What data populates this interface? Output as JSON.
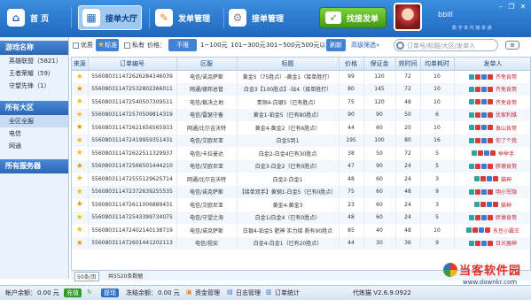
{
  "topbar": {
    "home": "首 页",
    "hall": "接单大厅",
    "send_manage": "发单管理",
    "recv_manage": "接单管理",
    "find_btn": "找接发单",
    "username": "bbill",
    "slogan": "数 字 未 代 接 单 通"
  },
  "sidebar": {
    "group1_title": "游戏名称",
    "games": [
      "英雄联盟（5821）",
      "王者荣耀（59）",
      "守望先锋（1）"
    ],
    "group2_title": "所有大区",
    "regions": [
      "全区全服",
      "电信",
      "网通"
    ],
    "group3_title": "所有服务器"
  },
  "filter": {
    "opt1": "优质",
    "opt2": "标准",
    "opt3": "私有",
    "price_label": "价格：",
    "price_all": "不限",
    "p1": "1~100元",
    "p2": "101~300元",
    "p3": "301~500元",
    "p4": "500元以上",
    "refresh": "刷新",
    "advanced": "高级筛选",
    "search_placeholder": "订单号/标题/大区/发单人"
  },
  "table": {
    "headers": [
      "来源",
      "订单编号",
      "区服",
      "标题",
      "价格",
      "保证金",
      "效时间",
      "均单耗时",
      "发单人"
    ],
    "rows": [
      {
        "order": "556080311472626284346039",
        "region": "电信/诺克萨斯",
        "title": "黄金5（75胜点）-黄金1（接单胜打）",
        "price": "99",
        "deposit": "120",
        "eff": "72",
        "avg": "10",
        "pub": "齐免肯努"
      },
      {
        "order": "556080311472532802366011",
        "region": "网通/德邦总管",
        "title": "白金3【100胜点】-钻4（接单胜打）",
        "price": "80",
        "deposit": "145",
        "eff": "72",
        "avg": "10",
        "pub": "齐免肯努"
      },
      {
        "order": "556080311472540507309511",
        "region": "电信/裁决之地",
        "title": "青铜4-白银5（已有胜点）",
        "price": "75",
        "deposit": "120",
        "eff": "48",
        "avg": "10",
        "pub": "齐免肯努"
      },
      {
        "order": "556080311472570509814319",
        "region": "电信/雷瑟守备",
        "title": "黄金1-铂金5（已有80胜点）",
        "price": "90",
        "deposit": "90",
        "eff": "50",
        "avg": "6",
        "pub": "优家利维"
      },
      {
        "order": "556080311472621656565933",
        "region": "网通/比尔吉沃特",
        "title": "黄金4-黄金2（已有6胜点）",
        "price": "44",
        "deposit": "60",
        "eff": "20",
        "avg": "10",
        "pub": "泰山肯努"
      },
      {
        "order": "556080311472419959351431",
        "region": "电信/艾欧尼亚",
        "title": "白金5到1",
        "price": "195",
        "deposit": "100",
        "eff": "80",
        "avg": "16",
        "pub": "你了个我"
      },
      {
        "order": "556080311472622511329937",
        "region": "电信/卡拉曼达",
        "title": "白金2-白金4已有30胜点",
        "price": "38",
        "deposit": "50",
        "eff": "72",
        "avg": "5",
        "pub": "举举手"
      },
      {
        "order": "556080311472566501444210",
        "region": "电信/艾欧尼亚",
        "title": "白金3-白金2（已有0胜点）",
        "price": "47",
        "deposit": "90",
        "eff": "24",
        "avg": "5",
        "pub": "胖墩肯努"
      },
      {
        "order": "556080311472555129625714",
        "region": "网通/比尔吉沃特",
        "title": "白金2-白金1",
        "price": "48",
        "deposit": "60",
        "eff": "24",
        "avg": "3",
        "pub": "猫神"
      },
      {
        "order": "556080311472372639255535",
        "region": "电信/诺克萨斯",
        "title": "【接单双手】黄钢1-白金5（已有0胜点）",
        "price": "75",
        "deposit": "60",
        "eff": "48",
        "avg": "9",
        "pub": "明小军隐"
      },
      {
        "order": "556080311472611006889431",
        "region": "电信/艾欧尼亚",
        "title": "黄金4-黄金3",
        "price": "23",
        "deposit": "60",
        "eff": "24",
        "avg": "3",
        "pub": "猫神"
      },
      {
        "order": "556080311472543399734075",
        "region": "电信/守望之海",
        "title": "白金1/白金4（已有0胜点）",
        "price": "48",
        "deposit": "60",
        "eff": "24",
        "avg": "5",
        "pub": "胖墩肯努"
      },
      {
        "order": "556080311472402140138719",
        "region": "电信/诺克萨斯",
        "title": "白银4-铂金5 肥神 实力接 质有90胜点",
        "price": "85",
        "deposit": "40",
        "eff": "48",
        "avg": "10",
        "pub": "东豆小霸王"
      },
      {
        "order": "556080311472601441202113",
        "region": "电信/祖安",
        "title": "白金4-白金1（已有20胜点）",
        "price": "44",
        "deposit": "30",
        "eff": "36",
        "avg": "9",
        "pub": "日光器神"
      }
    ]
  },
  "pager": {
    "per_page": "50条/页",
    "total": "共5520条数据"
  },
  "status": {
    "balance_label": "帐户余额：",
    "balance": "0.00 元",
    "recharge": "充值",
    "withdraw": "提现",
    "frozen_label": "冻结余额：",
    "frozen": "0.00 元",
    "fund_manage": "资金管理",
    "log_manage": "日志管理",
    "order_stats": "订单统计",
    "version": "代练猫  V2.6.9.0922"
  },
  "watermark": {
    "text": "当客软件园",
    "url": "www.downkr.com"
  },
  "colors": {
    "topbar": "#1f68bf",
    "publisher": "#c7202c",
    "star": "#f0c01b"
  }
}
